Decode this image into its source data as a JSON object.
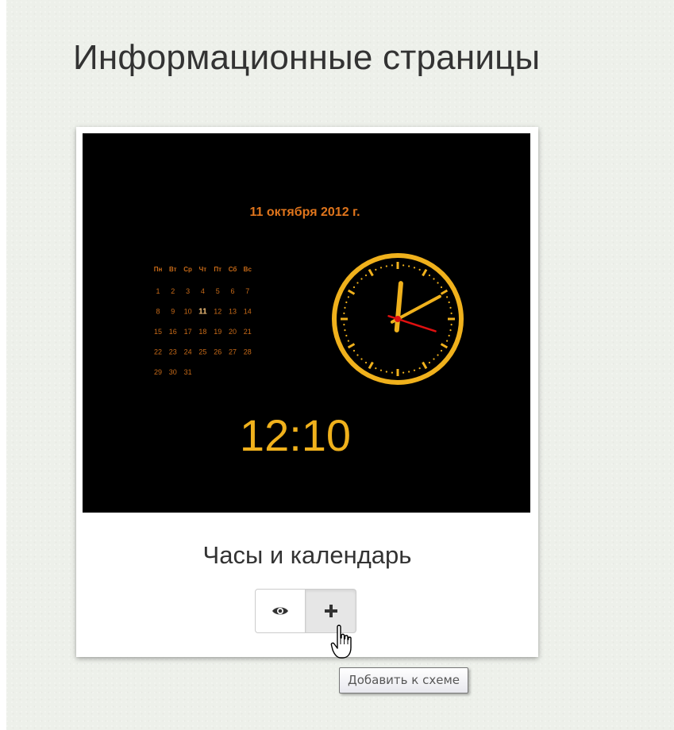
{
  "page": {
    "title": "Информационные страницы"
  },
  "widget_card": {
    "title": "Часы и календарь",
    "preview": {
      "date_label": "11 октября 2012 г.",
      "weekdays": [
        "Пн",
        "Вт",
        "Ср",
        "Чт",
        "Пт",
        "Сб",
        "Вс"
      ],
      "weeks": [
        [
          "1",
          "2",
          "3",
          "4",
          "5",
          "6",
          "7"
        ],
        [
          "8",
          "9",
          "10",
          "11",
          "12",
          "13",
          "14"
        ],
        [
          "15",
          "16",
          "17",
          "18",
          "19",
          "20",
          "21"
        ],
        [
          "22",
          "23",
          "24",
          "25",
          "26",
          "27",
          "28"
        ],
        [
          "29",
          "30",
          "31"
        ]
      ],
      "current_day": "11",
      "digital_time": "12:10",
      "clock": {
        "hour": 12,
        "minute": 10,
        "second": 18
      },
      "colors": {
        "background": "#000000",
        "accent": "#f0b11c",
        "calendar_text": "#c76a18",
        "date_text": "#e0751c",
        "second_hand": "#e01010"
      }
    },
    "buttons": {
      "preview_icon": "eye-icon",
      "add_icon": "plus-icon"
    }
  },
  "tooltip": {
    "text": "Добавить к схеме"
  },
  "cursor": {
    "icon": "hand-pointer-icon"
  }
}
